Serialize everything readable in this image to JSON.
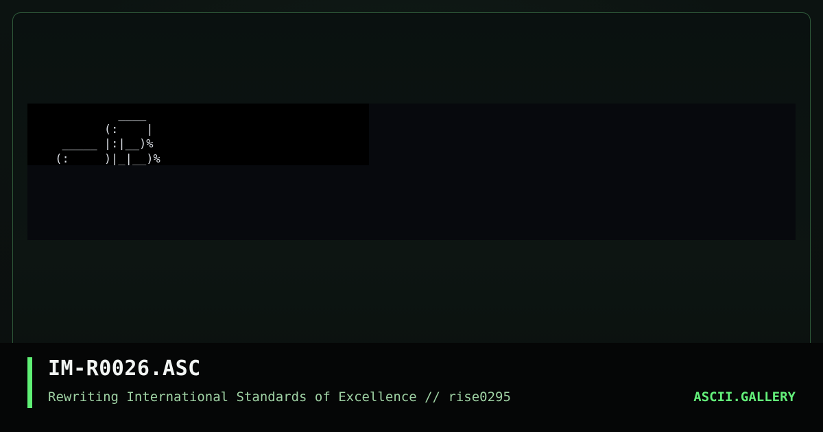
{
  "artwork": {
    "lines": "          ____\n        (:    |\n  _____ |:|__)%\n (:     )|_|__)%"
  },
  "footer": {
    "title": "IM-R0026.ASC",
    "subtitle": "Rewriting International Standards of Excellence // rise0295",
    "brand": "ASCII.GALLERY"
  },
  "colors": {
    "accent": "#5ff075",
    "brand": "#63f07a",
    "subtitle": "#9fd2a4",
    "frame_border": "#2f5a3a"
  }
}
